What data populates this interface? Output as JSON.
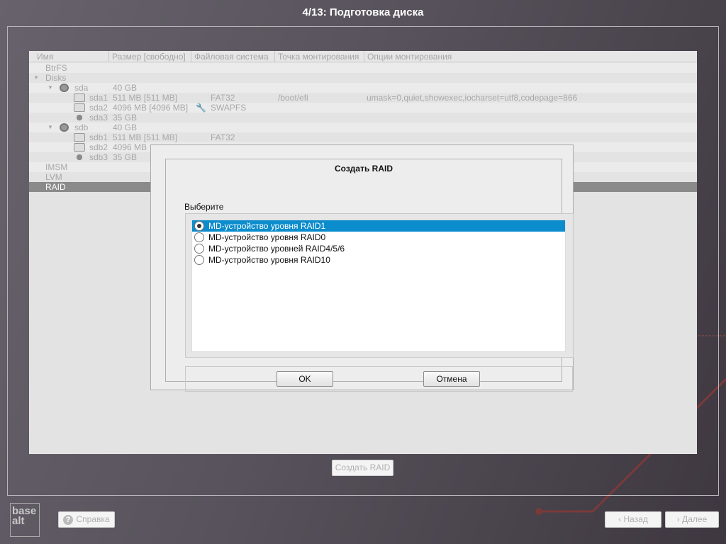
{
  "title": "4/13: Подготовка диска",
  "tree": {
    "columns": [
      "Имя",
      "Размер [свободно]",
      "Файловая система",
      "Точка монтирования",
      "Опции монтирования"
    ],
    "rows": [
      {
        "name": "BtrFS",
        "size": "",
        "fs": "",
        "mount": "",
        "opts": "",
        "level": 0,
        "icon": ""
      },
      {
        "name": "Disks",
        "size": "",
        "fs": "",
        "mount": "",
        "opts": "",
        "level": 0,
        "icon": "expander"
      },
      {
        "name": "sda",
        "size": "40 GB",
        "fs": "",
        "mount": "",
        "opts": "",
        "level": 1,
        "icon": "disk"
      },
      {
        "name": "sda1",
        "size": "511 MB [511 MB]",
        "fs": "FAT32",
        "mount": "/boot/efi",
        "opts": "umask=0,quiet,showexec,iocharset=utf8,codepage=866",
        "level": 2,
        "icon": "partition"
      },
      {
        "name": "sda2",
        "size": "4096 MB [4096 MB]",
        "fs": "SWAPFS",
        "mount": "",
        "opts": "",
        "level": 2,
        "icon": "partition",
        "wrench": true
      },
      {
        "name": "sda3",
        "size": "35 GB",
        "fs": "",
        "mount": "",
        "opts": "",
        "level": 2,
        "icon": "free"
      },
      {
        "name": "sdb",
        "size": "40 GB",
        "fs": "",
        "mount": "",
        "opts": "",
        "level": 1,
        "icon": "disk"
      },
      {
        "name": "sdb1",
        "size": "511 MB [511 MB]",
        "fs": "FAT32",
        "mount": "",
        "opts": "",
        "level": 2,
        "icon": "partition"
      },
      {
        "name": "sdb2",
        "size": "4096 MB",
        "fs": "",
        "mount": "",
        "opts": "",
        "level": 2,
        "icon": "partition"
      },
      {
        "name": "sdb3",
        "size": "35 GB",
        "fs": "",
        "mount": "",
        "opts": "",
        "level": 2,
        "icon": "free"
      },
      {
        "name": "IMSM",
        "size": "",
        "fs": "",
        "mount": "",
        "opts": "",
        "level": 0,
        "icon": ""
      },
      {
        "name": "LVM",
        "size": "",
        "fs": "",
        "mount": "",
        "opts": "",
        "level": 0,
        "icon": ""
      },
      {
        "name": "RAID",
        "size": "",
        "fs": "",
        "mount": "",
        "opts": "",
        "level": 0,
        "icon": "",
        "selected": true
      }
    ]
  },
  "dialog": {
    "title": "Создать RAID",
    "prompt": "Выберите",
    "options": [
      "MD-устройство уровня RAID1",
      "MD-устройство уровня RAID0",
      "MD-устройство уровней RAID4/5/6",
      "MD-устройство уровня RAID10"
    ],
    "selected": 0,
    "ok": "OK",
    "cancel": "Отмена"
  },
  "create_raid": "Создать RAID",
  "footer": {
    "help": "Справка",
    "back": "Назад",
    "next": "Далее",
    "logo": "basealt"
  }
}
